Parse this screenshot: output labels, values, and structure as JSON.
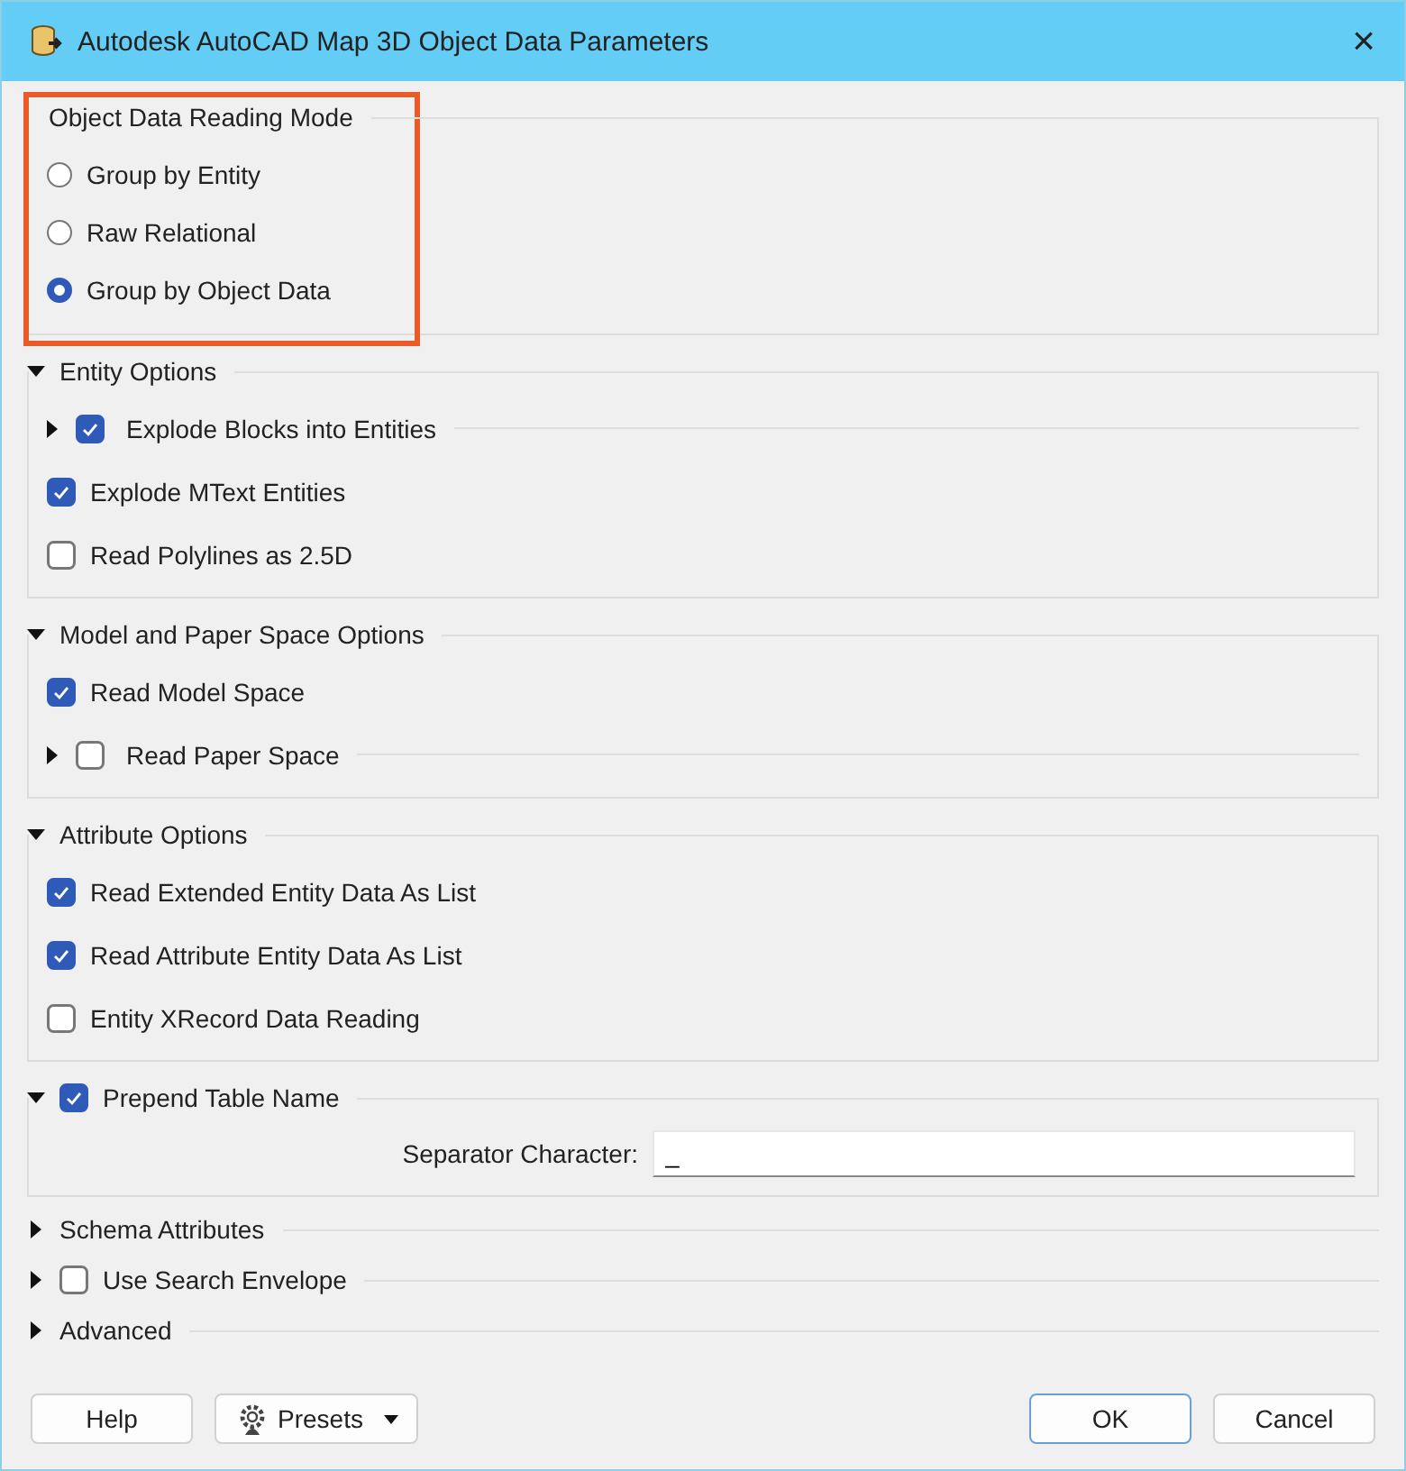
{
  "window": {
    "title": "Autodesk AutoCAD Map 3D Object Data Parameters",
    "close": "×"
  },
  "reading_mode": {
    "title": "Object Data Reading Mode",
    "highlighted": true,
    "options": [
      {
        "label": "Group by Entity",
        "selected": false
      },
      {
        "label": "Raw Relational",
        "selected": false
      },
      {
        "label": "Group by Object Data",
        "selected": true
      }
    ]
  },
  "sections": [
    {
      "title": "Entity Options",
      "expanded": true,
      "items": [
        {
          "kind": "checkbox",
          "label": "Explode Blocks into Entities",
          "checked": true,
          "expanded": false
        },
        {
          "kind": "checkbox",
          "label": "Explode MText Entities",
          "checked": true
        },
        {
          "kind": "checkbox",
          "label": "Read Polylines as 2.5D",
          "checked": false
        }
      ]
    },
    {
      "title": "Model and Paper Space Options",
      "expanded": true,
      "items": [
        {
          "kind": "checkbox",
          "label": "Read Model Space",
          "checked": true
        },
        {
          "kind": "checkbox",
          "label": "Read Paper Space",
          "checked": false,
          "expanded": false
        }
      ]
    },
    {
      "title": "Attribute Options",
      "expanded": true,
      "items": [
        {
          "kind": "checkbox",
          "label": "Read Extended Entity Data As List",
          "checked": true
        },
        {
          "kind": "checkbox",
          "label": "Read Attribute Entity Data As List",
          "checked": true
        },
        {
          "kind": "checkbox",
          "label": "Entity XRecord Data Reading",
          "checked": false
        }
      ]
    },
    {
      "title": "Prepend Table Name",
      "expanded": true,
      "checked": true,
      "items": [
        {
          "kind": "field",
          "label": "Separator Character:",
          "value": "_"
        }
      ]
    },
    {
      "title": "Schema Attributes",
      "expanded": false
    },
    {
      "title": "Use Search Envelope",
      "expanded": false,
      "checked": false
    },
    {
      "title": "Advanced",
      "expanded": false
    }
  ],
  "buttons": [
    {
      "label": "Help",
      "kind": "plain"
    },
    {
      "label": "Presets",
      "kind": "menu"
    },
    {
      "label": "OK",
      "kind": "default"
    },
    {
      "label": "Cancel",
      "kind": "plain"
    }
  ]
}
